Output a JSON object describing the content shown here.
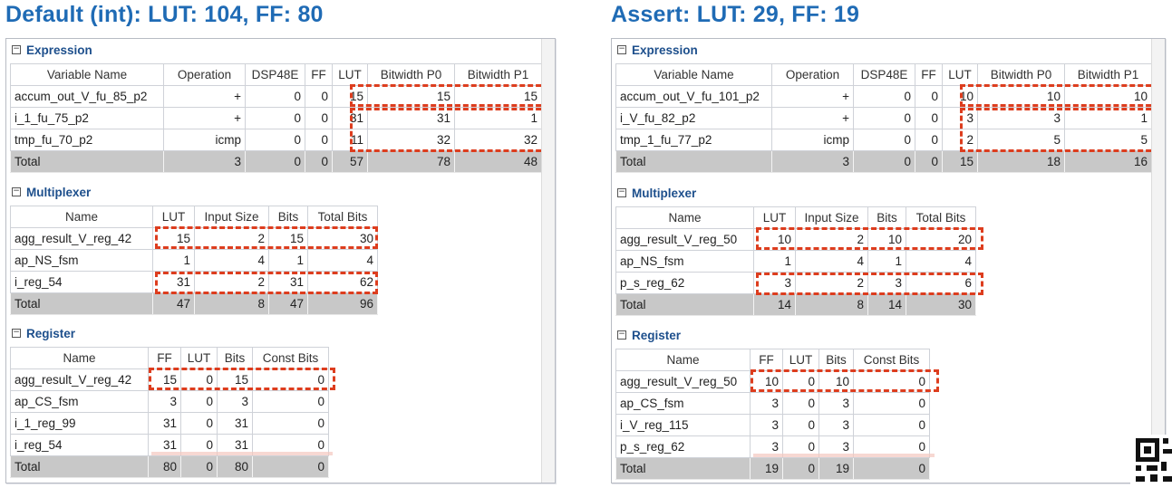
{
  "left": {
    "title": "Default (int): LUT: 104, FF: 80",
    "expression": {
      "label": "Expression",
      "headers": [
        "Variable Name",
        "Operation",
        "DSP48E",
        "FF",
        "LUT",
        "Bitwidth P0",
        "Bitwidth P1"
      ],
      "rows": [
        [
          "accum_out_V_fu_85_p2",
          "+",
          "0",
          "0",
          "15",
          "15",
          "15"
        ],
        [
          "i_1_fu_75_p2",
          "+",
          "0",
          "0",
          "31",
          "31",
          "1"
        ],
        [
          "tmp_fu_70_p2",
          "icmp",
          "0",
          "0",
          "11",
          "32",
          "32"
        ]
      ],
      "total": [
        "Total",
        "3",
        "0",
        "0",
        "57",
        "78",
        "48"
      ]
    },
    "multiplexer": {
      "label": "Multiplexer",
      "headers": [
        "Name",
        "LUT",
        "Input Size",
        "Bits",
        "Total Bits"
      ],
      "rows": [
        [
          "agg_result_V_reg_42",
          "15",
          "2",
          "15",
          "30"
        ],
        [
          "ap_NS_fsm",
          "1",
          "4",
          "1",
          "4"
        ],
        [
          "i_reg_54",
          "31",
          "2",
          "31",
          "62"
        ]
      ],
      "total": [
        "Total",
        "47",
        "8",
        "47",
        "96"
      ]
    },
    "register": {
      "label": "Register",
      "headers": [
        "Name",
        "FF",
        "LUT",
        "Bits",
        "Const Bits"
      ],
      "rows": [
        [
          "agg_result_V_reg_42",
          "15",
          "0",
          "15",
          "0"
        ],
        [
          "ap_CS_fsm",
          "3",
          "0",
          "3",
          "0"
        ],
        [
          "i_1_reg_99",
          "31",
          "0",
          "31",
          "0"
        ],
        [
          "i_reg_54",
          "31",
          "0",
          "31",
          "0"
        ]
      ],
      "total": [
        "Total",
        "80",
        "0",
        "80",
        "0"
      ]
    }
  },
  "right": {
    "title": "Assert: LUT: 29, FF: 19",
    "expression": {
      "label": "Expression",
      "headers": [
        "Variable Name",
        "Operation",
        "DSP48E",
        "FF",
        "LUT",
        "Bitwidth P0",
        "Bitwidth P1"
      ],
      "rows": [
        [
          "accum_out_V_fu_101_p2",
          "+",
          "0",
          "0",
          "10",
          "10",
          "10"
        ],
        [
          "i_V_fu_82_p2",
          "+",
          "0",
          "0",
          "3",
          "3",
          "1"
        ],
        [
          "tmp_1_fu_77_p2",
          "icmp",
          "0",
          "0",
          "2",
          "5",
          "5"
        ]
      ],
      "total": [
        "Total",
        "3",
        "0",
        "0",
        "15",
        "18",
        "16"
      ]
    },
    "multiplexer": {
      "label": "Multiplexer",
      "headers": [
        "Name",
        "LUT",
        "Input Size",
        "Bits",
        "Total Bits"
      ],
      "rows": [
        [
          "agg_result_V_reg_50",
          "10",
          "2",
          "10",
          "20"
        ],
        [
          "ap_NS_fsm",
          "1",
          "4",
          "1",
          "4"
        ],
        [
          "p_s_reg_62",
          "3",
          "2",
          "3",
          "6"
        ]
      ],
      "total": [
        "Total",
        "14",
        "8",
        "14",
        "30"
      ]
    },
    "register": {
      "label": "Register",
      "headers": [
        "Name",
        "FF",
        "LUT",
        "Bits",
        "Const Bits"
      ],
      "rows": [
        [
          "agg_result_V_reg_50",
          "10",
          "0",
          "10",
          "0"
        ],
        [
          "ap_CS_fsm",
          "3",
          "0",
          "3",
          "0"
        ],
        [
          "i_V_reg_115",
          "3",
          "0",
          "3",
          "0"
        ],
        [
          "p_s_reg_62",
          "3",
          "0",
          "3",
          "0"
        ]
      ],
      "total": [
        "Total",
        "19",
        "0",
        "19",
        "0"
      ]
    }
  },
  "icons": {
    "section_toggle": "collapse-minus-icon",
    "corner": "qr-code-icon"
  },
  "colors": {
    "title": "#1f6bb5",
    "section": "#1d4f8c",
    "highlight": "#dd3d1e",
    "total_row": "#c8c8c8"
  }
}
